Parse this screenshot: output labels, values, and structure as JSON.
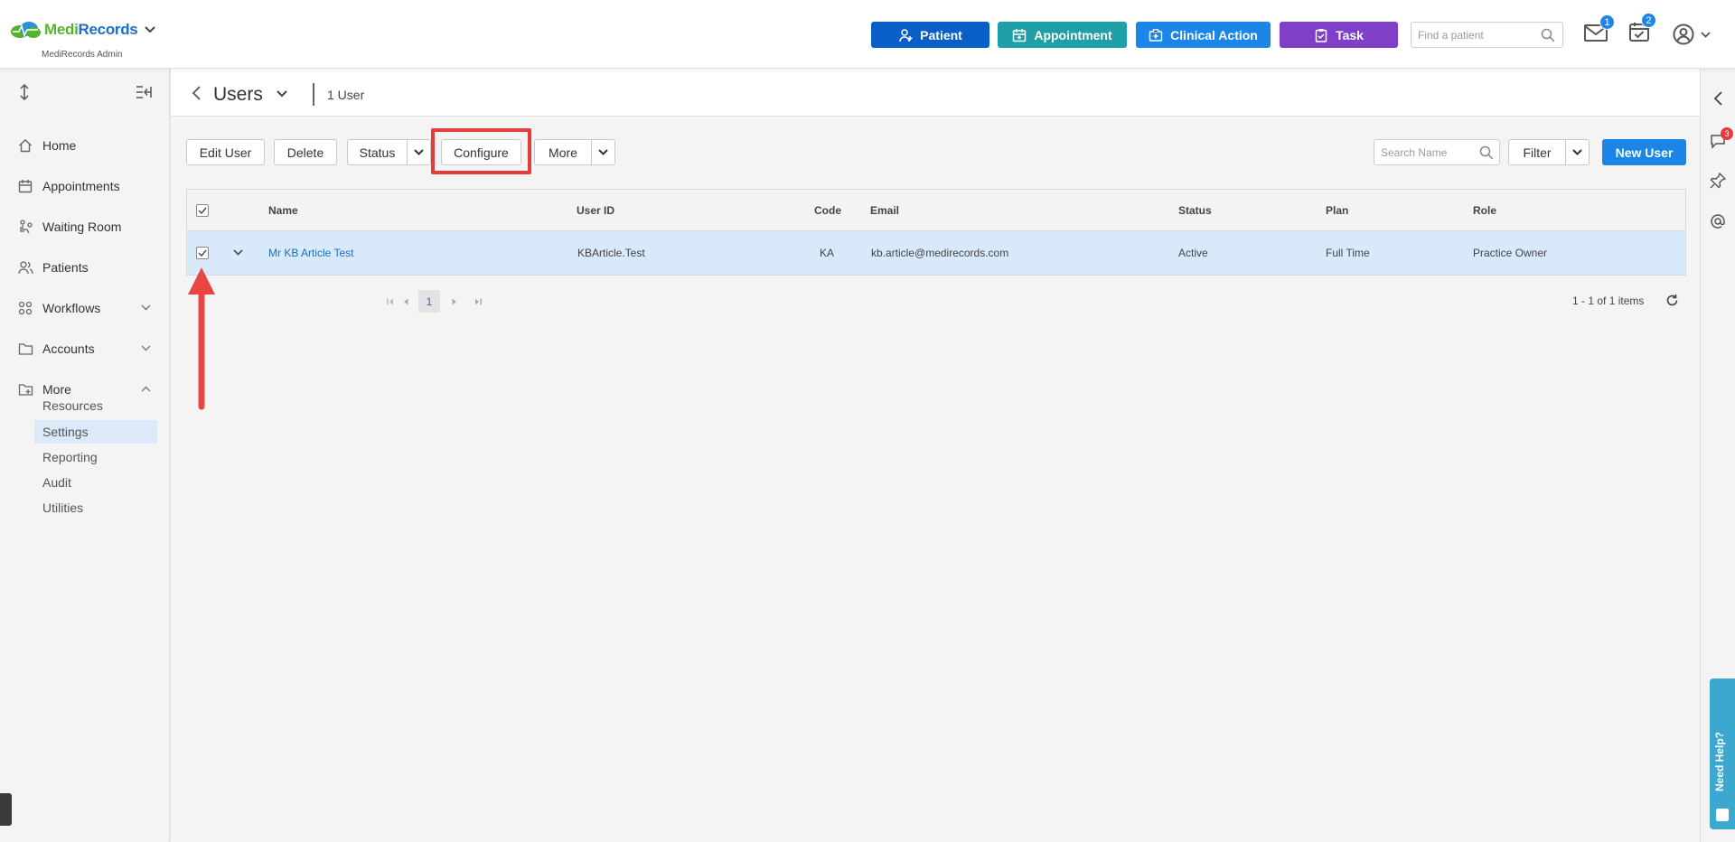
{
  "app": {
    "brand_part1": "Medi",
    "brand_part2": "Records",
    "org_name": "MediRecords Admin"
  },
  "topbar": {
    "actions": [
      {
        "label": "Patient",
        "color": "#0a5fc7",
        "icon": "add-person-icon"
      },
      {
        "label": "Appointment",
        "color": "#1f9fa8",
        "icon": "calendar-icon"
      },
      {
        "label": "Clinical Action",
        "color": "#1b86e8",
        "icon": "medical-case-icon"
      },
      {
        "label": "Task",
        "color": "#7f3fc9",
        "icon": "clipboard-icon"
      }
    ],
    "find_patient_placeholder": "Find a patient",
    "mail_badge": "1",
    "tasks_badge": "2"
  },
  "sidebar": {
    "items": [
      {
        "label": "Home",
        "icon": "home-icon"
      },
      {
        "label": "Appointments",
        "icon": "calendar-icon"
      },
      {
        "label": "Waiting Room",
        "icon": "waiting-room-icon"
      },
      {
        "label": "Patients",
        "icon": "people-icon"
      },
      {
        "label": "Workflows",
        "icon": "workflow-icon"
      },
      {
        "label": "Accounts",
        "icon": "folder-icon"
      },
      {
        "label": "More",
        "icon": "folder-plus-icon"
      }
    ],
    "more_sub_items": [
      {
        "label": "Resources"
      },
      {
        "label": "Settings",
        "active": true
      },
      {
        "label": "Reporting"
      },
      {
        "label": "Audit"
      },
      {
        "label": "Utilities"
      }
    ]
  },
  "page": {
    "title": "Users",
    "count_label": "1 User"
  },
  "toolbar": {
    "edit_user": "Edit User",
    "delete": "Delete",
    "status": "Status",
    "configure": "Configure",
    "more": "More",
    "search_placeholder": "Search Name",
    "filter": "Filter",
    "new_user": "New User",
    "highlight_color": "#e43c3c"
  },
  "grid": {
    "columns": [
      "Name",
      "User ID",
      "Code",
      "Email",
      "Status",
      "Plan",
      "Role"
    ],
    "rows": [
      {
        "name": "Mr KB Article Test",
        "user_id": "KBArticle.Test",
        "code": "KA",
        "email": "kb.article@medirecords.com",
        "status": "Active",
        "plan": "Full Time",
        "role": "Practice Owner"
      }
    ],
    "current_page": "1",
    "items_info": "1 - 1 of 1 items"
  },
  "right_rail": {
    "chat_badge": "3",
    "need_help": "Need Help?"
  }
}
